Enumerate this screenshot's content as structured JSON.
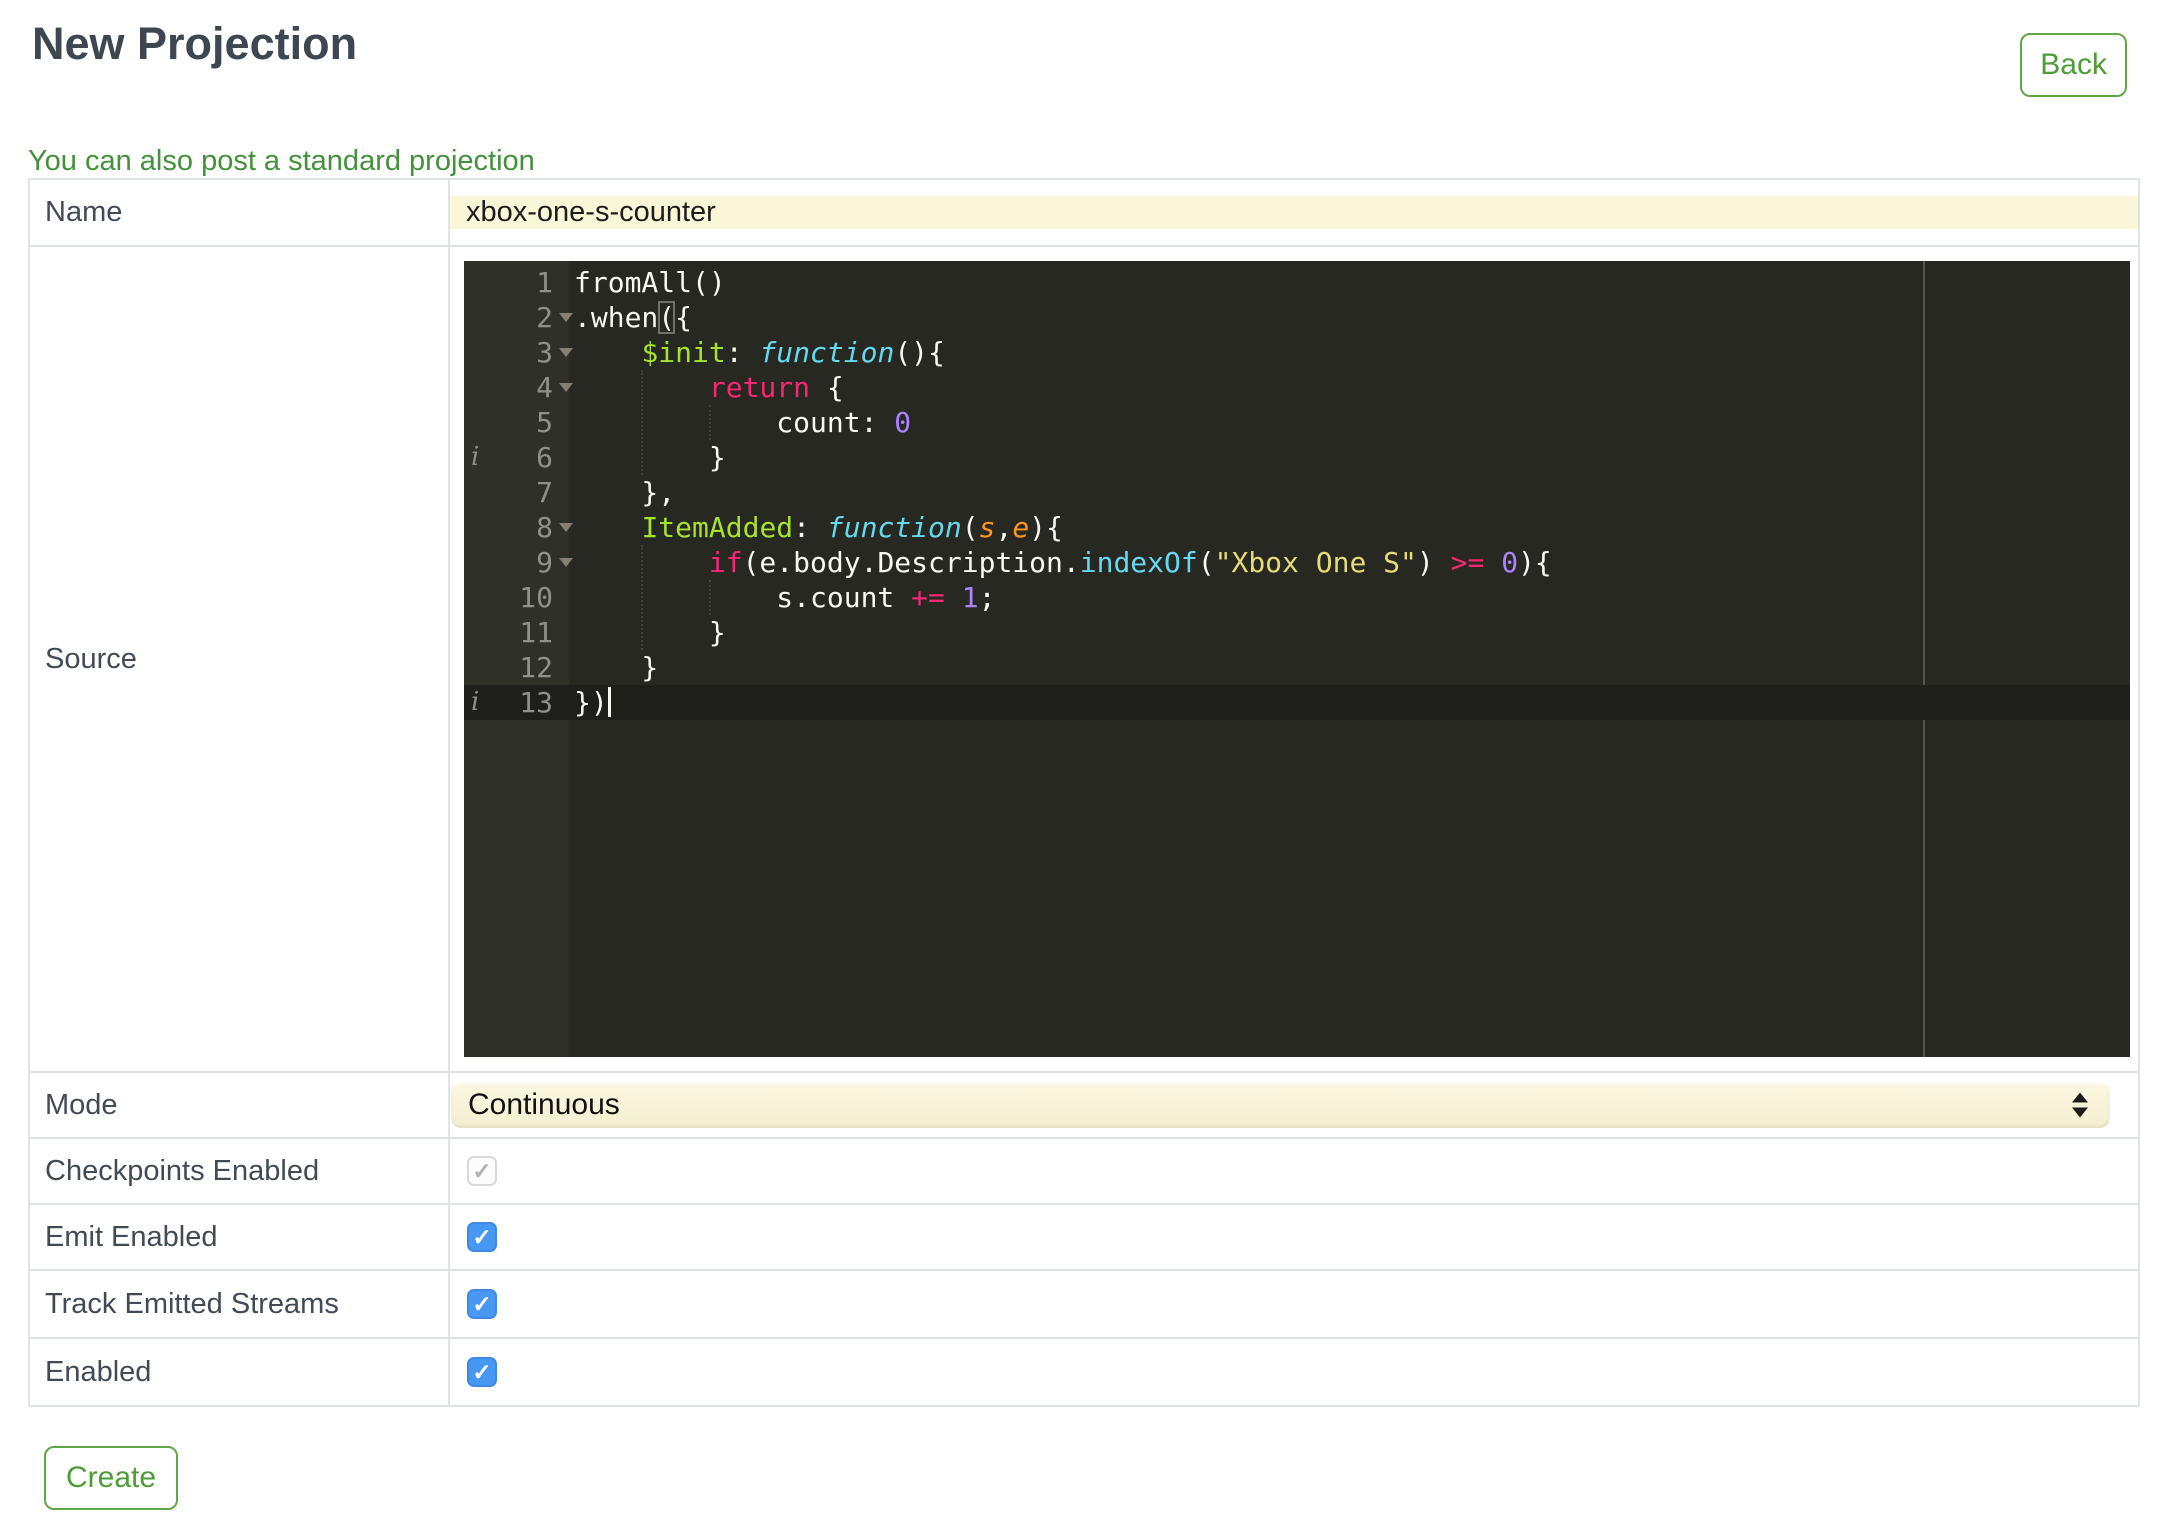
{
  "header": {
    "title": "New Projection",
    "back_label": "Back",
    "link_text": "You can also post a standard projection"
  },
  "colors": {
    "accent_green": "#4E9C36",
    "link_green": "#44913B",
    "checkbox_blue": "#4897F3",
    "field_yellow": "#FAF6D8",
    "editor_bg": "#272822",
    "editor_gutter_bg": "#2F3129",
    "syntax": {
      "plain": "#F8F8F2",
      "property": "#A6E22E",
      "keyword": "#F92672",
      "number": "#AE81FF",
      "string": "#E6DB74",
      "function": "#66D9EF",
      "parameter": "#FD971F",
      "line_number": "#8F908A"
    }
  },
  "form": {
    "create_label": "Create",
    "rows": [
      {
        "label": "Name",
        "type": "text",
        "value": "xbox-one-s-counter"
      },
      {
        "label": "Source",
        "type": "editor"
      },
      {
        "label": "Mode",
        "type": "select",
        "value": "Continuous"
      },
      {
        "label": "Checkpoints Enabled",
        "type": "checkbox",
        "checked": true,
        "disabled": true
      },
      {
        "label": "Emit Enabled",
        "type": "checkbox",
        "checked": true,
        "disabled": false
      },
      {
        "label": "Track Emitted Streams",
        "type": "checkbox",
        "checked": true,
        "disabled": false
      },
      {
        "label": "Enabled",
        "type": "checkbox",
        "checked": true,
        "disabled": false
      }
    ]
  },
  "editor": {
    "active_line": 13,
    "source_text": "fromAll()\n.when({\n    $init: function(){\n        return {\n            count: 0\n        }\n    },\n    ItemAdded: function(s,e){\n        if(e.body.Description.indexOf(\"Xbox One S\") >= 0){\n            s.count += 1;\n        }\n    }\n})",
    "lines": [
      {
        "n": 1,
        "tokens": [
          [
            "w",
            "fromAll()"
          ]
        ]
      },
      {
        "n": 2,
        "fold": true,
        "tokens": [
          [
            "w",
            ".when"
          ],
          [
            "wm",
            "("
          ],
          [
            "w",
            "{"
          ]
        ]
      },
      {
        "n": 3,
        "fold": true,
        "tokens": [
          [
            "w",
            "    "
          ],
          [
            "g",
            "$init"
          ],
          [
            "w",
            ": "
          ],
          [
            "ci",
            "function"
          ],
          [
            "w",
            "(){"
          ]
        ]
      },
      {
        "n": 4,
        "fold": true,
        "tokens": [
          [
            "w",
            "        "
          ],
          [
            "p",
            "return"
          ],
          [
            "w",
            " {"
          ]
        ]
      },
      {
        "n": 5,
        "tokens": [
          [
            "w",
            "            count: "
          ],
          [
            "pu",
            "0"
          ]
        ]
      },
      {
        "n": 6,
        "info": true,
        "tokens": [
          [
            "w",
            "        }"
          ]
        ]
      },
      {
        "n": 7,
        "tokens": [
          [
            "w",
            "    },"
          ]
        ]
      },
      {
        "n": 8,
        "fold": true,
        "tokens": [
          [
            "w",
            "    "
          ],
          [
            "g",
            "ItemAdded"
          ],
          [
            "w",
            ": "
          ],
          [
            "ci",
            "function"
          ],
          [
            "w",
            "("
          ],
          [
            "oi",
            "s"
          ],
          [
            "w",
            ","
          ],
          [
            "oi",
            "e"
          ],
          [
            "w",
            "){"
          ]
        ]
      },
      {
        "n": 9,
        "fold": true,
        "tokens": [
          [
            "w",
            "        "
          ],
          [
            "p",
            "if"
          ],
          [
            "w",
            "(e.body.Description."
          ],
          [
            "cy",
            "indexOf"
          ],
          [
            "w",
            "("
          ],
          [
            "y",
            "\"Xbox One S\""
          ],
          [
            "w",
            ") "
          ],
          [
            "p",
            ">="
          ],
          [
            "w",
            " "
          ],
          [
            "pu",
            "0"
          ],
          [
            "w",
            "){"
          ]
        ]
      },
      {
        "n": 10,
        "tokens": [
          [
            "w",
            "            s.count "
          ],
          [
            "p",
            "+="
          ],
          [
            "w",
            " "
          ],
          [
            "pu",
            "1"
          ],
          [
            "w",
            ";"
          ]
        ]
      },
      {
        "n": 11,
        "tokens": [
          [
            "w",
            "        }"
          ]
        ]
      },
      {
        "n": 12,
        "tokens": [
          [
            "w",
            "    }"
          ]
        ]
      },
      {
        "n": 13,
        "info": true,
        "cursor": true,
        "tokens": [
          [
            "w",
            "})"
          ]
        ]
      }
    ]
  }
}
